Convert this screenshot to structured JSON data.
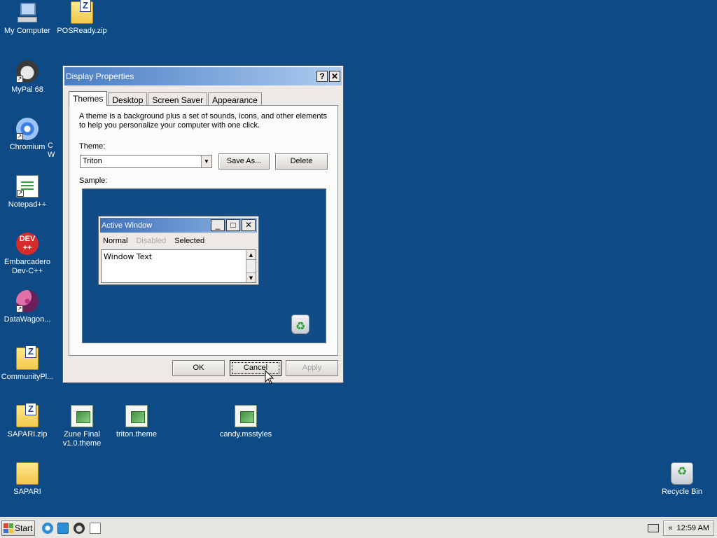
{
  "desktop": {
    "icons": [
      {
        "label": "My Computer"
      },
      {
        "label": "POSReady.zip"
      },
      {
        "label": "MyPal 68"
      },
      {
        "label": "Chromium"
      },
      {
        "label": "Notepad++"
      },
      {
        "label": "Embarcadero Dev-C++"
      },
      {
        "label": "DataWagon..."
      },
      {
        "label": "CommunityPl..."
      },
      {
        "label": "SAPARI.zip"
      },
      {
        "label": "Zune Final v1.0.theme"
      },
      {
        "label": "triton.theme"
      },
      {
        "label": "candy.msstyles"
      },
      {
        "label": "SAPARI"
      },
      {
        "label": "Recycle Bin"
      }
    ],
    "partial_label": "C\nW",
    "dev_icon_text": "DEV\n++"
  },
  "dialog": {
    "title": "Display Properties",
    "help_btn": "?",
    "close_btn": "✕",
    "tabs": [
      "Themes",
      "Desktop",
      "Screen Saver",
      "Appearance"
    ],
    "description": "A theme is a background plus a set of sounds, icons, and other elements to help you personalize your computer with one click.",
    "theme_label": "Theme:",
    "theme_value": "Triton",
    "save_as": "Save As...",
    "delete": "Delete",
    "sample_label": "Sample:",
    "sample": {
      "window_title": "Active Window",
      "menu_normal": "Normal",
      "menu_disabled": "Disabled",
      "menu_selected": "Selected",
      "window_text": "Window Text"
    },
    "ok": "OK",
    "cancel": "Cancel",
    "apply": "Apply"
  },
  "taskbar": {
    "start": "Start",
    "chevron": "«",
    "clock": "12:59 AM"
  }
}
